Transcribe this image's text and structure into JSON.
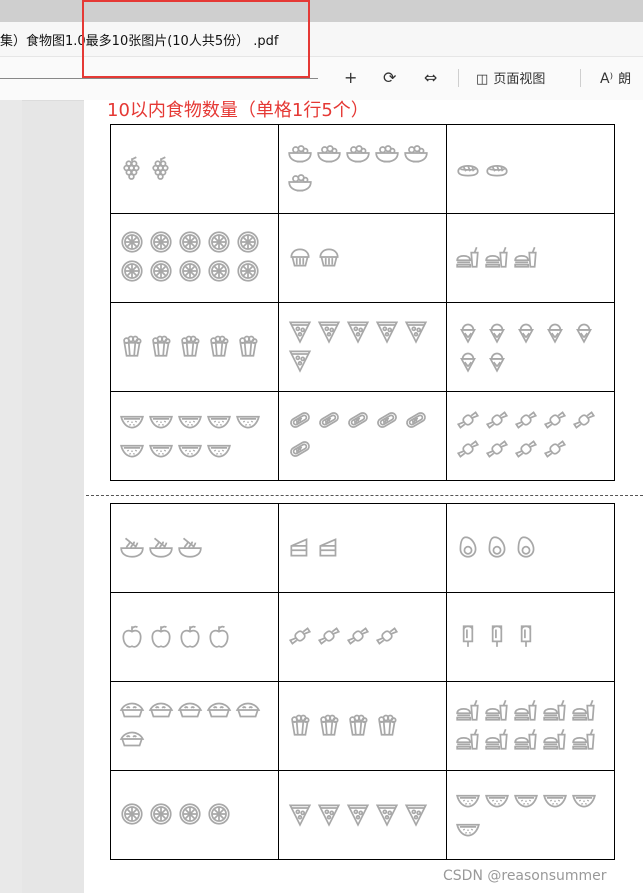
{
  "tab": {
    "title": "集）食物图1.0最多10张图片(10人共5份） .pdf"
  },
  "toolbar": {
    "zoom_in": "+",
    "rotate": "⟳",
    "fit_width": "⇔",
    "page_view_label": "页面视图",
    "read_aloud_label": "朗"
  },
  "page": {
    "title": "10以内食物数量（单格1行5个）"
  },
  "grid_top": [
    [
      {
        "food": "grapes-icon",
        "count": 2
      },
      {
        "food": "fruit-bowl-icon",
        "count": 6
      },
      {
        "food": "sushi-icon",
        "count": 2
      }
    ],
    [
      {
        "food": "orange-slice-icon",
        "count": 10
      },
      {
        "food": "muffin-icon",
        "count": 2
      },
      {
        "food": "burger-drink-icon",
        "count": 3
      }
    ],
    [
      {
        "food": "popcorn-icon",
        "count": 5
      },
      {
        "food": "pizza-slice-icon",
        "count": 6
      },
      {
        "food": "ice-cream-icon",
        "count": 7
      }
    ],
    [
      {
        "food": "watermelon-icon",
        "count": 9
      },
      {
        "food": "hotdog-icon",
        "count": 6
      },
      {
        "food": "candy-icon",
        "count": 9
      }
    ]
  ],
  "grid_bottom": [
    [
      {
        "food": "noodle-bowl-icon",
        "count": 3
      },
      {
        "food": "cake-slice-icon",
        "count": 2
      },
      {
        "food": "avocado-icon",
        "count": 3
      }
    ],
    [
      {
        "food": "apple-icon",
        "count": 4
      },
      {
        "food": "candy-icon",
        "count": 4
      },
      {
        "food": "popsicle-icon",
        "count": 3
      }
    ],
    [
      {
        "food": "pie-icon",
        "count": 6
      },
      {
        "food": "popcorn-icon",
        "count": 4
      },
      {
        "food": "burger-drink-icon",
        "count": 10
      }
    ],
    [
      {
        "food": "orange-slice-icon",
        "count": 4
      },
      {
        "food": "pizza-slice-icon",
        "count": 5
      },
      {
        "food": "watermelon-icon",
        "count": 6
      }
    ]
  ],
  "watermark": "CSDN @reasonsummer"
}
